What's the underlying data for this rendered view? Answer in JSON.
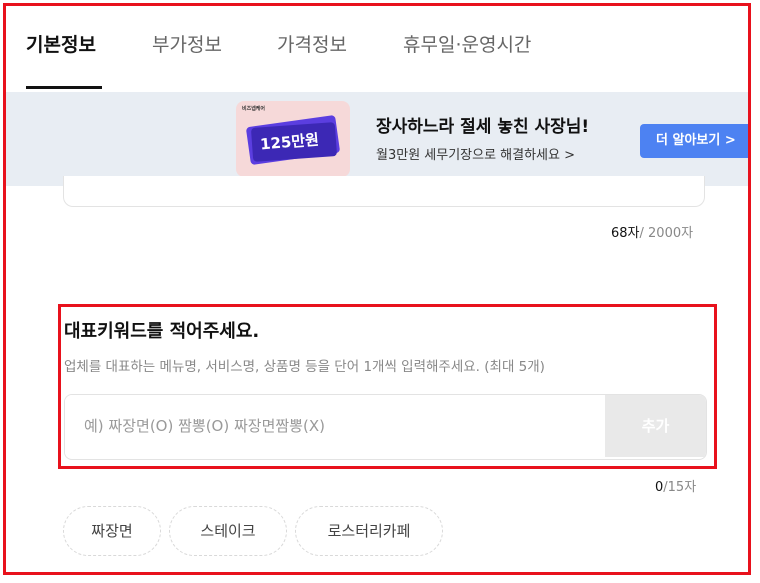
{
  "tabs": [
    {
      "label": "기본정보",
      "active": true
    },
    {
      "label": "부가정보",
      "active": false
    },
    {
      "label": "가격정보",
      "active": false
    },
    {
      "label": "휴무일·운영시간",
      "active": false
    }
  ],
  "banner": {
    "thumb_brand": "비즈넵케어",
    "thumb_amount": "125만원",
    "title": "장사하느라 절세 놓친 사장님!",
    "subtitle": "월3만원 세무기장으로 해결하세요 >",
    "button_label": "더 알아보기 >"
  },
  "description": {
    "count_current": "68자",
    "count_total": "/ 2000자"
  },
  "keywords": {
    "title": "대표키워드를 적어주세요.",
    "description": "업체를 대표하는 메뉴명, 서비스명, 상품명 등을 단어 1개씩 입력해주세요. (최대 5개)",
    "input_placeholder": "예) 짜장면(O) 짬뽕(O) 짜장면짬뽕(X)",
    "input_value": "",
    "add_label": "추가",
    "count_current": "0",
    "count_total": "/15자",
    "suggestions": [
      "짜장면",
      "스테이크",
      "로스터리카페"
    ]
  },
  "colors": {
    "highlight_border": "#e8111c",
    "banner_bg": "#e8edf3",
    "button_blue": "#4d82f2",
    "add_button_bg": "#e9e9e9"
  }
}
